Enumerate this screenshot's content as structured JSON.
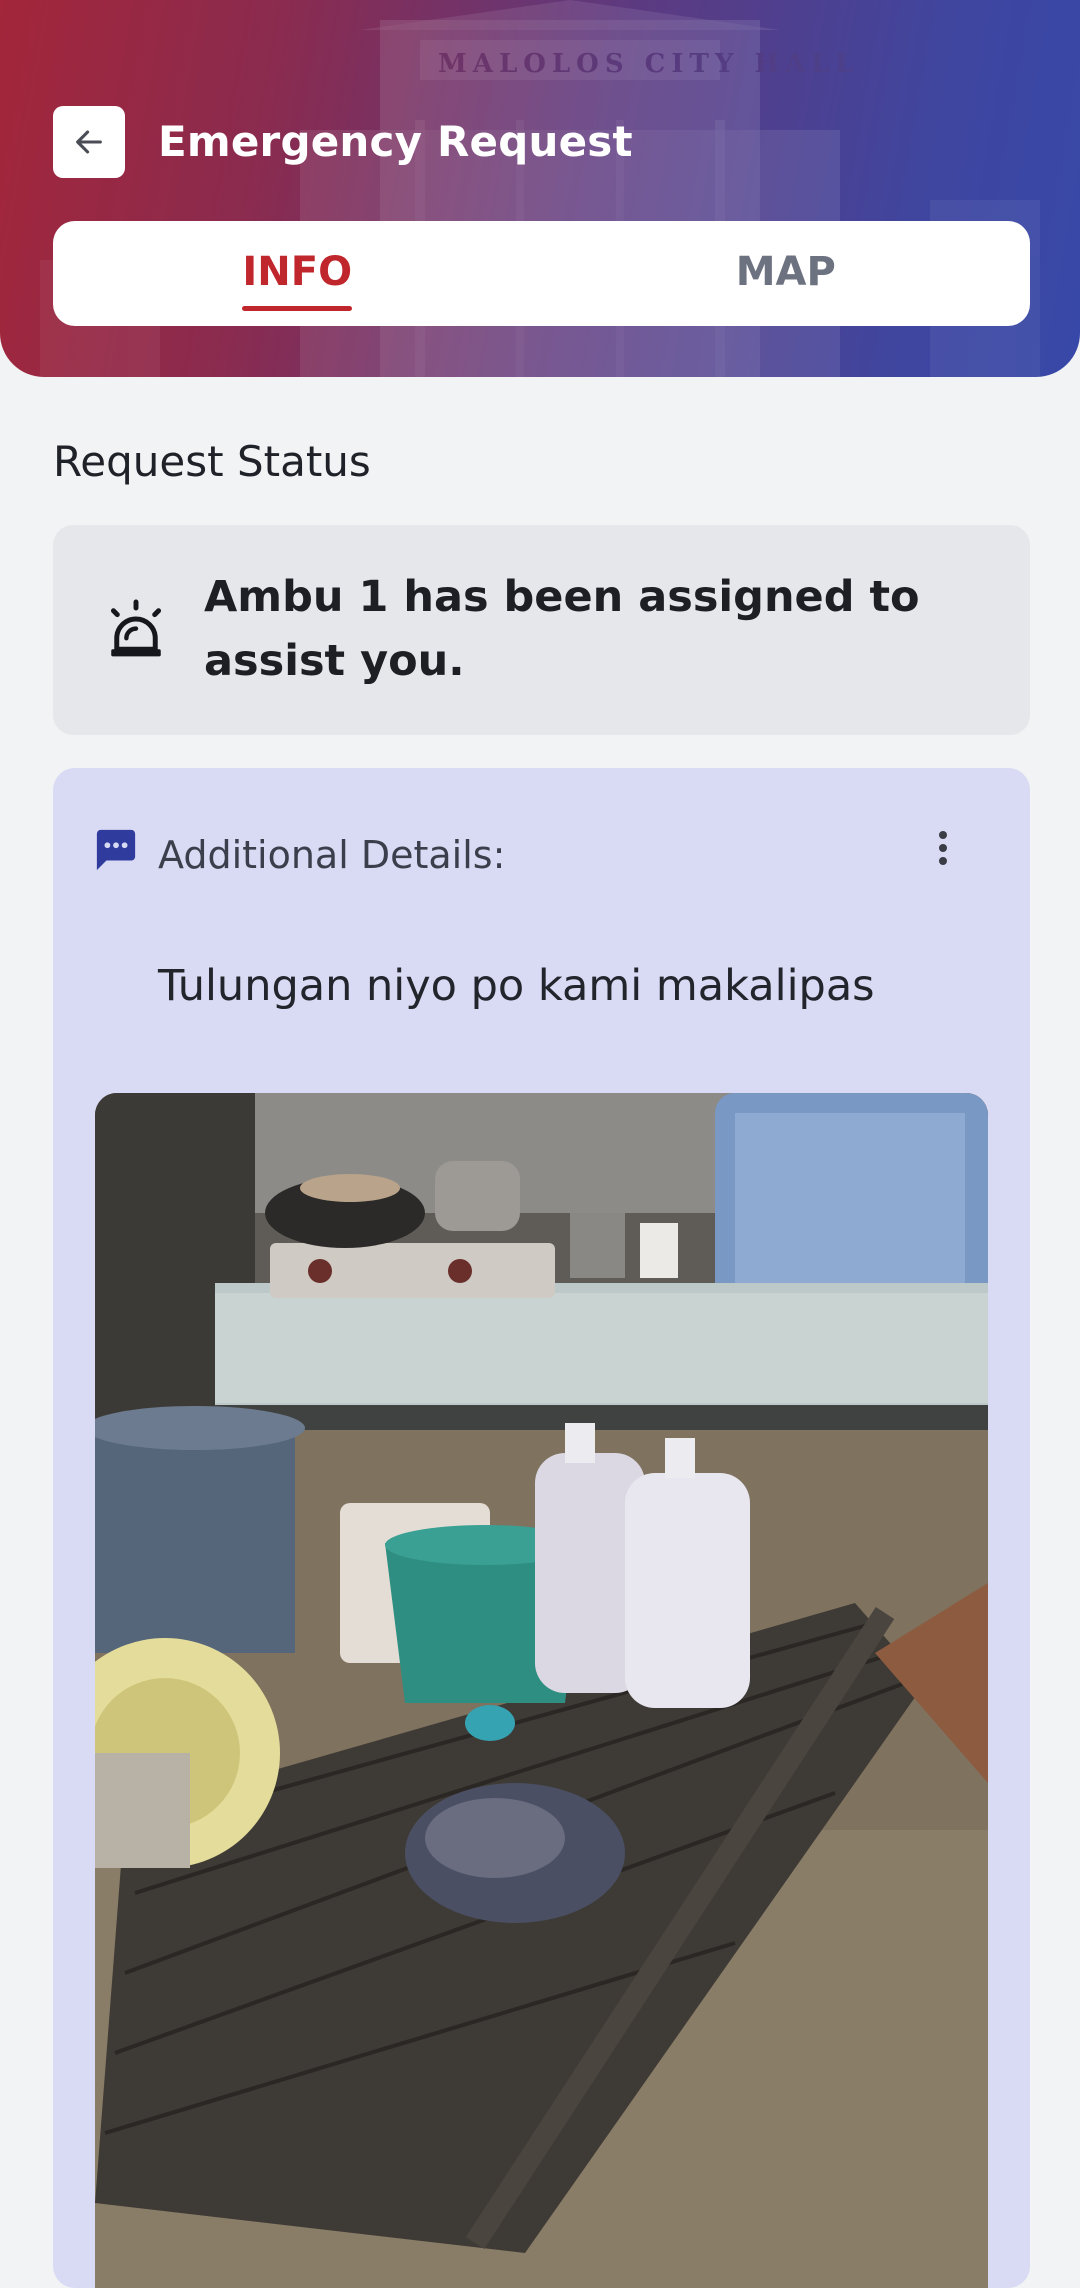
{
  "header": {
    "title": "Emergency Request",
    "back_icon": "arrow-left-icon",
    "background_watermark_text": "MALOLOS CITY HALL",
    "gradient_colors": [
      "#a3263a",
      "#3848a8"
    ]
  },
  "tabs": [
    {
      "label": "INFO",
      "active": true
    },
    {
      "label": "MAP",
      "active": false
    }
  ],
  "status": {
    "section_title": "Request Status",
    "icon": "siren-alarm-icon",
    "message": "Ambu 1 has been assigned to assist you."
  },
  "details": {
    "icon": "chat-bubble-icon",
    "label": "Additional Details:",
    "more_icon": "more-vertical-icon",
    "text": "Tulungan niyo po kami makalipas",
    "photo": "flooded-kitchen-photo"
  },
  "colors": {
    "accent_red": "#c0272d",
    "inactive_tab": "#6c7280",
    "details_bg": "#d9daf4",
    "status_bg": "#e6e7ea",
    "icon_blue": "#2f3c9e"
  }
}
